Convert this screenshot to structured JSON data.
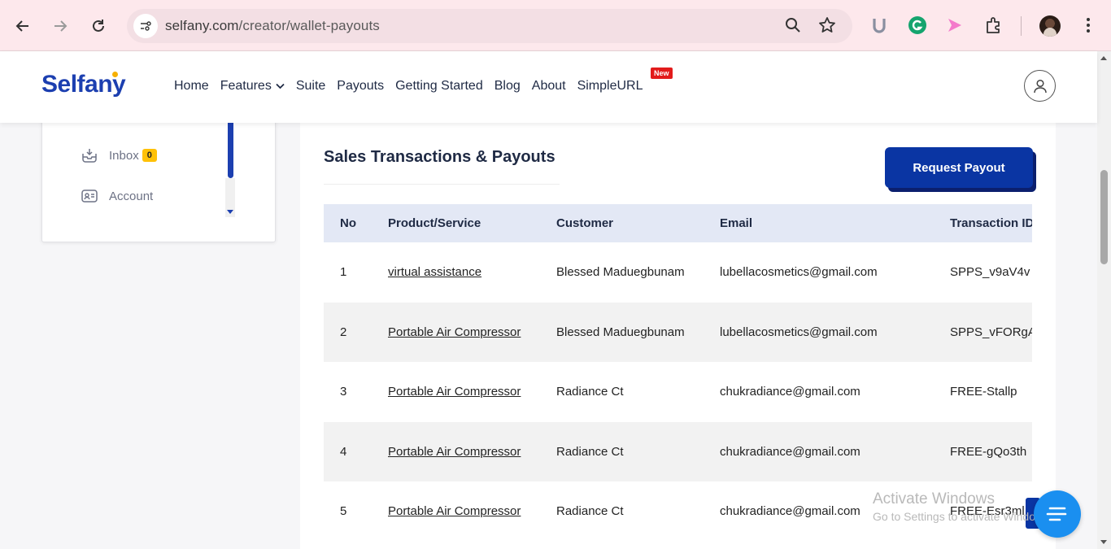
{
  "browser": {
    "url_domain": "selfany.com",
    "url_path": "/creator/wallet-payouts"
  },
  "site": {
    "logo": "Selfany",
    "nav": [
      "Home",
      "Features",
      "Suite",
      "Payouts",
      "Getting Started",
      "Blog",
      "About",
      "SimpleURL"
    ],
    "new_badge": "New"
  },
  "sidebar": {
    "items": [
      {
        "label": "Inbox",
        "badge": "0"
      },
      {
        "label": "Account"
      }
    ]
  },
  "main": {
    "title": "Sales Transactions & Payouts",
    "request_payout": "Request Payout",
    "columns": [
      "No",
      "Product/Service",
      "Customer",
      "Email",
      "Transaction ID"
    ],
    "rows": [
      [
        "1",
        "virtual assistance",
        "Blessed Maduegbunam",
        "lubellacosmetics@gmail.com",
        "SPPS_v9aV4v"
      ],
      [
        "2",
        "Portable Air Compressor",
        "Blessed Maduegbunam",
        "lubellacosmetics@gmail.com",
        "SPPS_vFORgA"
      ],
      [
        "3",
        "Portable Air Compressor",
        "Radiance Ct",
        "chukradiance@gmail.com",
        "FREE-Stallp"
      ],
      [
        "4",
        "Portable Air Compressor",
        "Radiance Ct",
        "chukradiance@gmail.com",
        "FREE-gQo3th"
      ],
      [
        "5",
        "Portable Air Compressor",
        "Radiance Ct",
        "chukradiance@gmail.com",
        "FREE-Esr3ml"
      ]
    ]
  },
  "os": {
    "watermark_line1": "Activate Windows",
    "watermark_line2": "Go to Settings to activate Windows."
  },
  "colors": {
    "brand": "#1c3fb0",
    "button": "#0a35a3",
    "badge": "#ffc107",
    "chat": "#1a8ff0"
  }
}
